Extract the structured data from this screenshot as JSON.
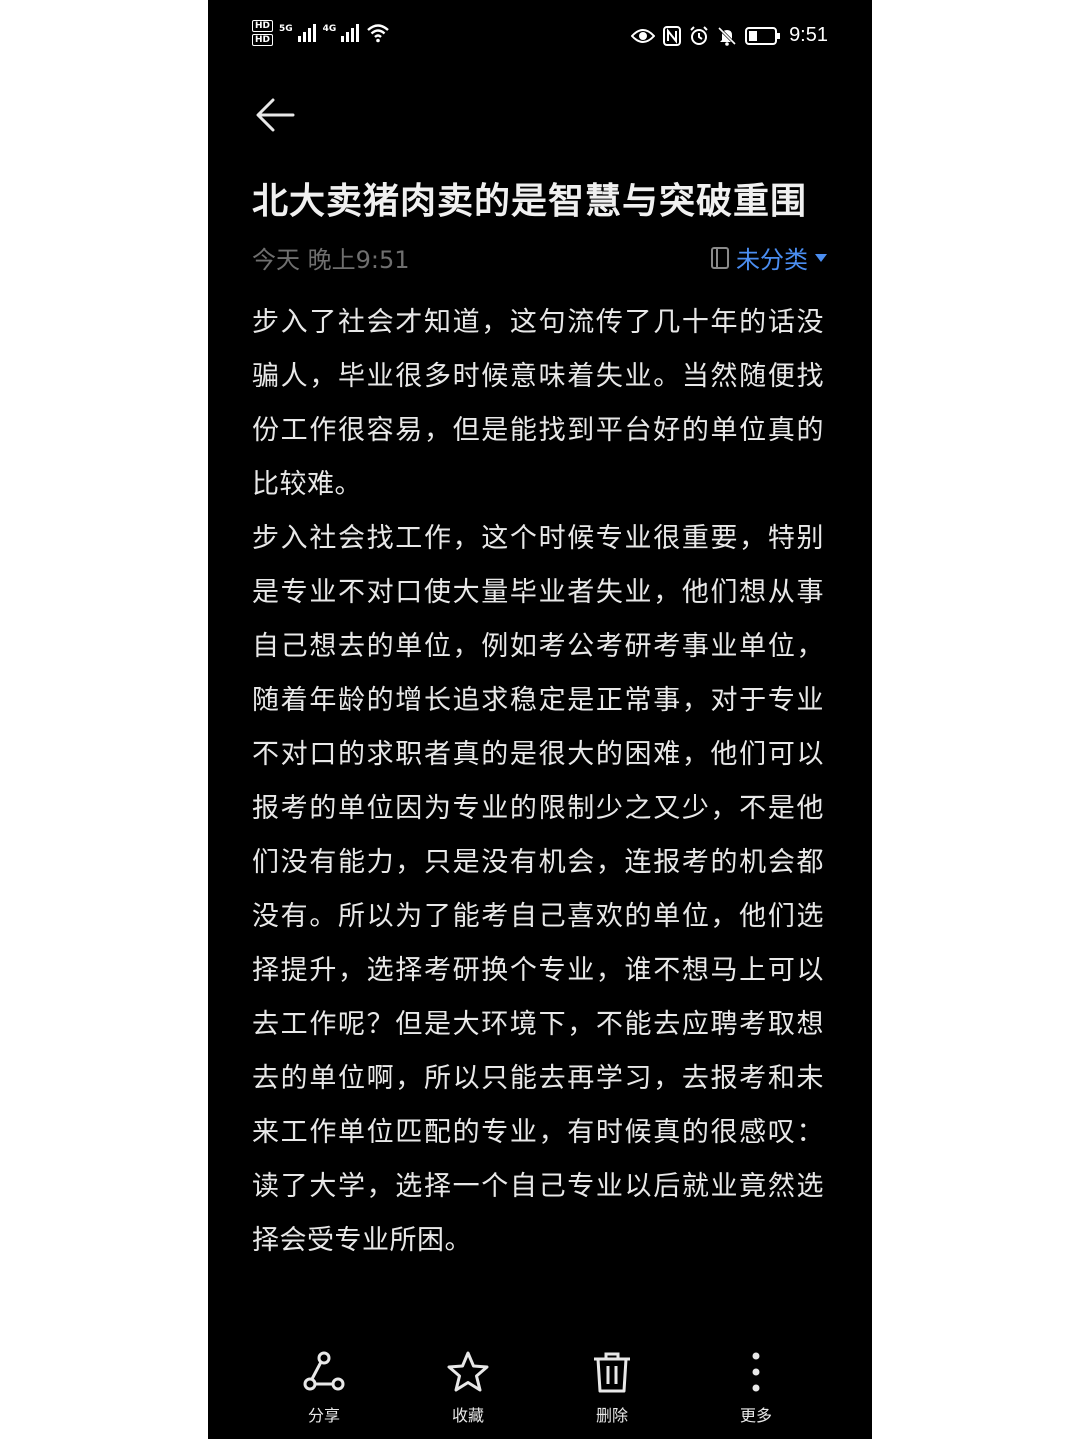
{
  "status_bar": {
    "hd_1": "HD",
    "hd_2": "HD",
    "net_1": "5G",
    "net_2": "4G",
    "time": "9:51"
  },
  "note": {
    "title": "北大卖猪肉卖的是智慧与突破重围",
    "date": "今天 晚上9:51",
    "category": "未分类",
    "paragraphs": [
      "步入了社会才知道，这句流传了几十年的话没骗人，毕业很多时候意味着失业。当然随便找份工作很容易，但是能找到平台好的单位真的比较难。",
      "步入社会找工作，这个时候专业很重要，特别是专业不对口使大量毕业者失业，他们想从事自己想去的单位，例如考公考研考事业单位，随着年龄的增长追求稳定是正常事，对于专业不对口的求职者真的是很大的困难，他们可以报考的单位因为专业的限制少之又少，不是他们没有能力，只是没有机会，连报考的机会都没有。所以为了能考自己喜欢的单位，他们选择提升，选择考研换个专业，谁不想马上可以去工作呢？但是大环境下，不能去应聘考取想去的单位啊，所以只能去再学习，去报考和未来工作单位匹配的专业，有时候真的很感叹：读了大学，选择一个自己专业以后就业竟然选择会受专业所困。"
    ]
  },
  "toolbar": {
    "share_label": "分享",
    "favorite_label": "收藏",
    "delete_label": "删除",
    "more_label": "更多"
  },
  "colors": {
    "background": "#000000",
    "text": "#e8e8e8",
    "muted": "#6f6f6f",
    "accent": "#4b8ef1"
  },
  "icons": {
    "back": "arrow-left-icon",
    "category": "folder-icon",
    "dropdown": "triangle-down-icon",
    "share": "share-icon",
    "favorite": "star-icon",
    "delete": "trash-icon",
    "more": "more-vertical-icon"
  }
}
